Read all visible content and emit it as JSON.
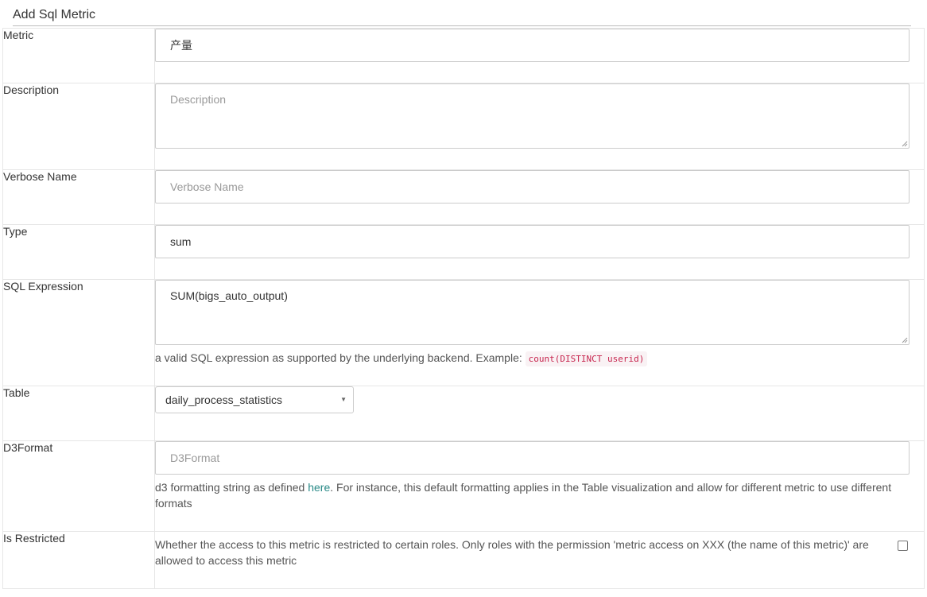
{
  "form": {
    "title": "Add Sql Metric",
    "metric": {
      "label": "Metric",
      "value": "产量"
    },
    "description": {
      "label": "Description",
      "placeholder": "Description"
    },
    "verbose_name": {
      "label": "Verbose Name",
      "placeholder": "Verbose Name"
    },
    "type": {
      "label": "Type",
      "value": "sum"
    },
    "sql_expression": {
      "label": "SQL Expression",
      "value": "SUM(bigs_auto_output)",
      "help": "a valid SQL expression as supported by the underlying backend. Example:",
      "example": "count(DISTINCT userid)"
    },
    "table": {
      "label": "Table",
      "selected": "daily_process_statistics"
    },
    "d3format": {
      "label": "D3Format",
      "placeholder": "D3Format",
      "help_prefix": "d3 formatting string as defined ",
      "help_link": "here",
      "help_suffix": ". For instance, this default formatting applies in the Table visualization and allow for different metric to use different formats"
    },
    "is_restricted": {
      "label": "Is Restricted",
      "help": "Whether the access to this metric is restricted to certain roles. Only roles with the permission 'metric access on XXX (the name of this metric)' are allowed to access this metric",
      "checked": false
    }
  },
  "colors": {
    "link": "#2a8a87",
    "code": "#c7254e",
    "border": "#cccccc"
  },
  "icons": {
    "select_caret": "caret-down-icon",
    "resize": "resize-handle-icon"
  }
}
